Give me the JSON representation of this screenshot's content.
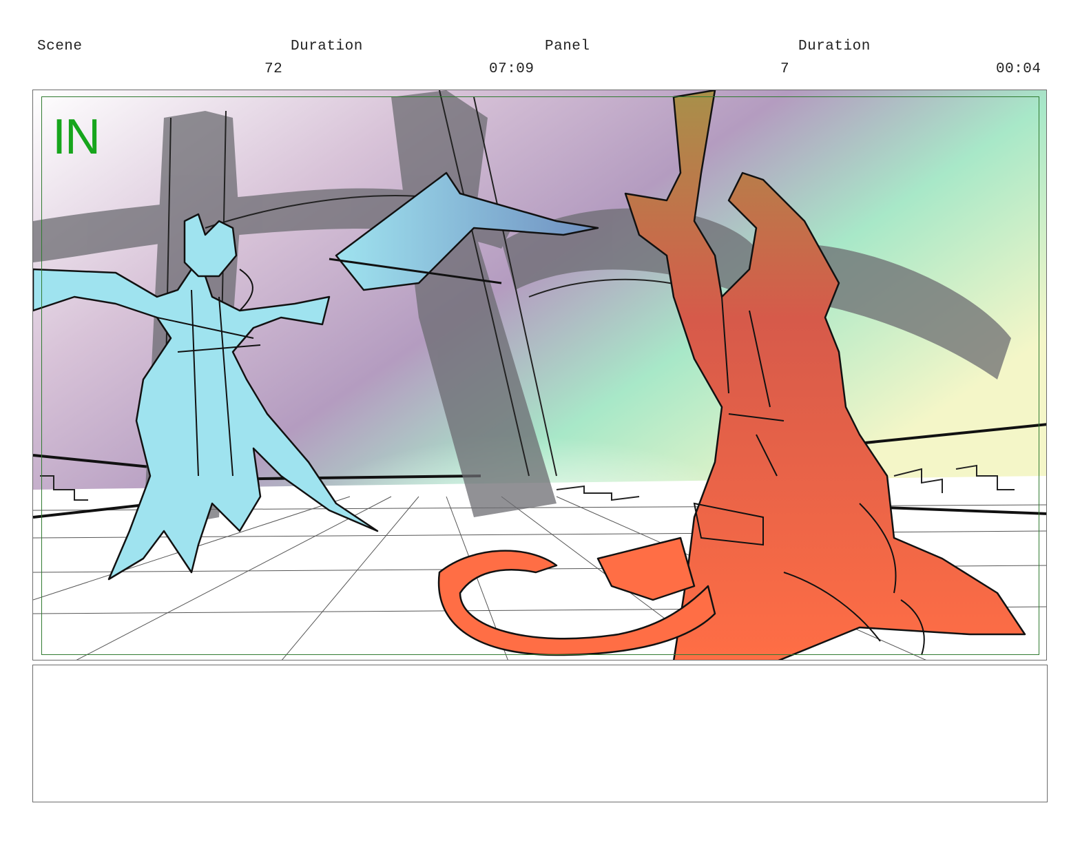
{
  "header": {
    "scene_label": "Scene",
    "scene_duration_label": "Duration",
    "panel_label": "Panel",
    "panel_duration_label": "Duration",
    "scene_number": "72",
    "scene_duration": "07:09",
    "panel_number": "7",
    "panel_duration": "00:04"
  },
  "panel": {
    "transition_label": "IN",
    "image_icon": "storyboard-sketch",
    "colors": {
      "transition_green": "#17a51c",
      "safe_frame": "#2f7a2f",
      "cyan_character": "#9fe3ef",
      "orange_character": "#ff6e45"
    }
  },
  "notes": {
    "text": ""
  }
}
